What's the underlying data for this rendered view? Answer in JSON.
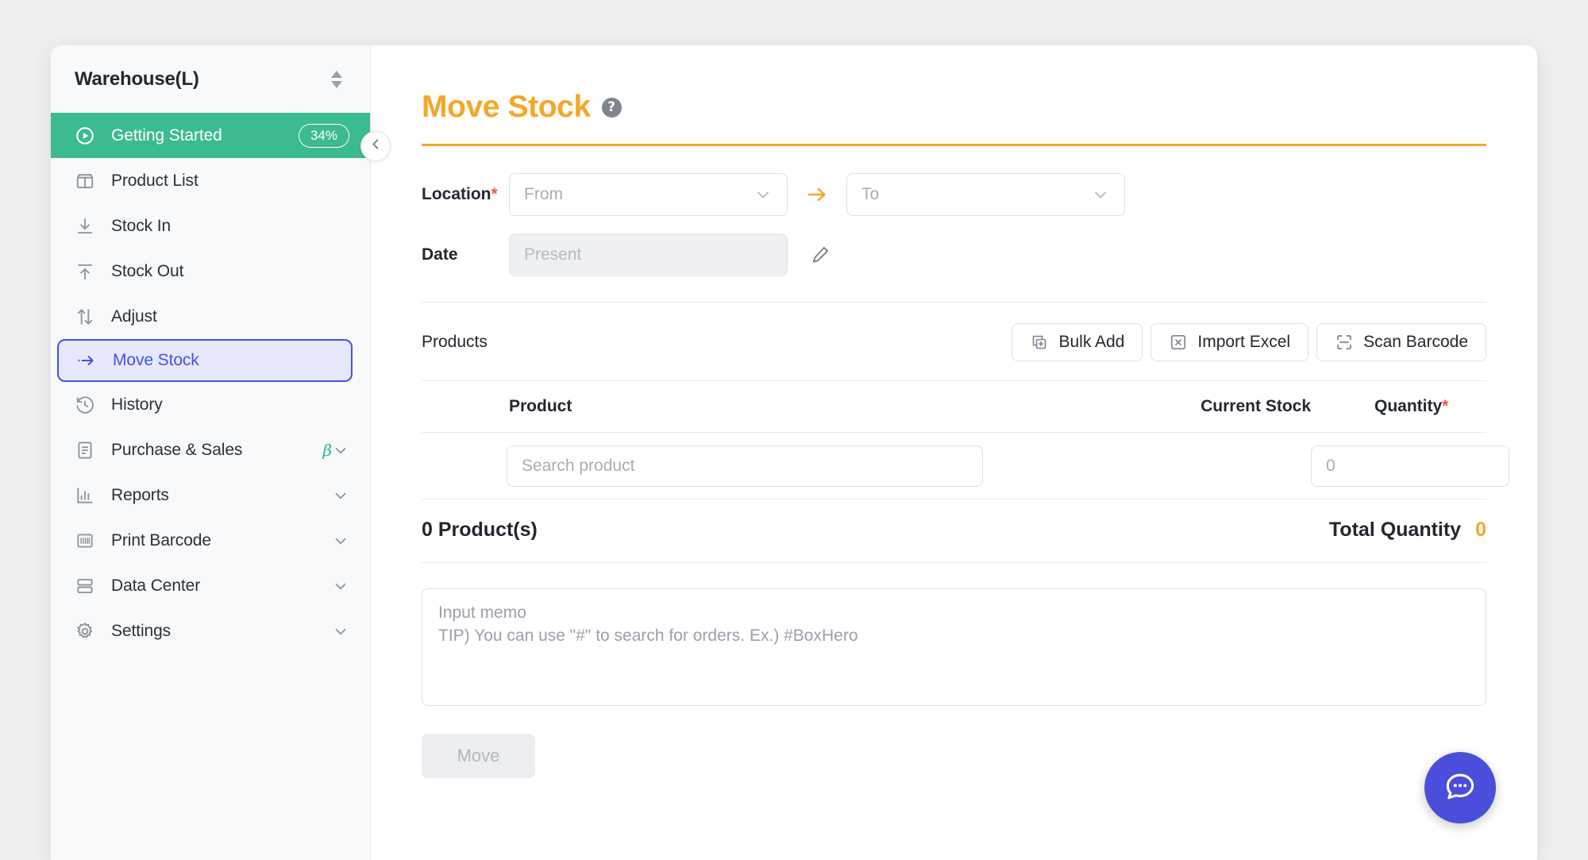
{
  "workspace": {
    "name": "Warehouse(L)",
    "switch_icon": "updown-caret-icon"
  },
  "sidebar": {
    "items": [
      {
        "label": "Getting Started",
        "icon": "play-circle-icon",
        "badge": "34%",
        "state": "active"
      },
      {
        "label": "Product List",
        "icon": "box-icon",
        "state": "normal"
      },
      {
        "label": "Stock In",
        "icon": "arrow-down-to-line-icon",
        "state": "normal"
      },
      {
        "label": "Stock Out",
        "icon": "arrow-up-from-line-icon",
        "state": "normal"
      },
      {
        "label": "Adjust",
        "icon": "up-down-arrows-icon",
        "state": "normal"
      },
      {
        "label": "Move Stock",
        "icon": "arrow-right-dot-icon",
        "state": "selected"
      },
      {
        "label": "History",
        "icon": "clock-rewind-icon",
        "state": "normal"
      },
      {
        "label": "Purchase & Sales",
        "icon": "document-icon",
        "beta": "β",
        "chevron": "chevron-down-icon",
        "state": "normal"
      },
      {
        "label": "Reports",
        "icon": "bar-chart-icon",
        "chevron": "chevron-down-icon",
        "state": "normal"
      },
      {
        "label": "Print Barcode",
        "icon": "barcode-icon",
        "chevron": "chevron-down-icon",
        "state": "normal"
      },
      {
        "label": "Data Center",
        "icon": "database-icon",
        "chevron": "chevron-down-icon",
        "state": "normal"
      },
      {
        "label": "Settings",
        "icon": "gear-icon",
        "chevron": "chevron-down-icon",
        "state": "normal"
      }
    ],
    "collapse_icon": "chevron-left-icon"
  },
  "page": {
    "title": "Move Stock",
    "help_icon": "question-mark-icon"
  },
  "form": {
    "location_label": "Location",
    "location_required": "*",
    "from_placeholder": "From",
    "to_placeholder": "To",
    "transfer_arrow": "arrow-right-icon",
    "date_label": "Date",
    "date_value": "Present",
    "date_edit_icon": "pencil-icon"
  },
  "products": {
    "section_label": "Products",
    "buttons": [
      {
        "label": "Bulk Add",
        "icon": "copy-plus-icon"
      },
      {
        "label": "Import Excel",
        "icon": "excel-x-icon"
      },
      {
        "label": "Scan Barcode",
        "icon": "scan-frame-icon"
      }
    ],
    "columns": {
      "product": "Product",
      "current_stock": "Current Stock",
      "quantity": "Quantity",
      "quantity_required": "*"
    },
    "row": {
      "search_placeholder": "Search product",
      "current_stock_value": "",
      "quantity_placeholder": "0"
    },
    "count_text": "0 Product(s)",
    "total_label": "Total Quantity",
    "total_value": "0"
  },
  "memo": {
    "placeholder": "Input memo\nTIP) You can use \"#\" to search for orders. Ex.) #BoxHero"
  },
  "footer": {
    "submit_label": "Move"
  },
  "support": {
    "chat_icon": "chat-support-icon"
  },
  "colors": {
    "accent_orange": "#f5a728",
    "active_green": "#3cba92",
    "selected_blue": "#4352e8",
    "required_red": "#f4554a",
    "chat_purple": "#4b4ddb"
  }
}
